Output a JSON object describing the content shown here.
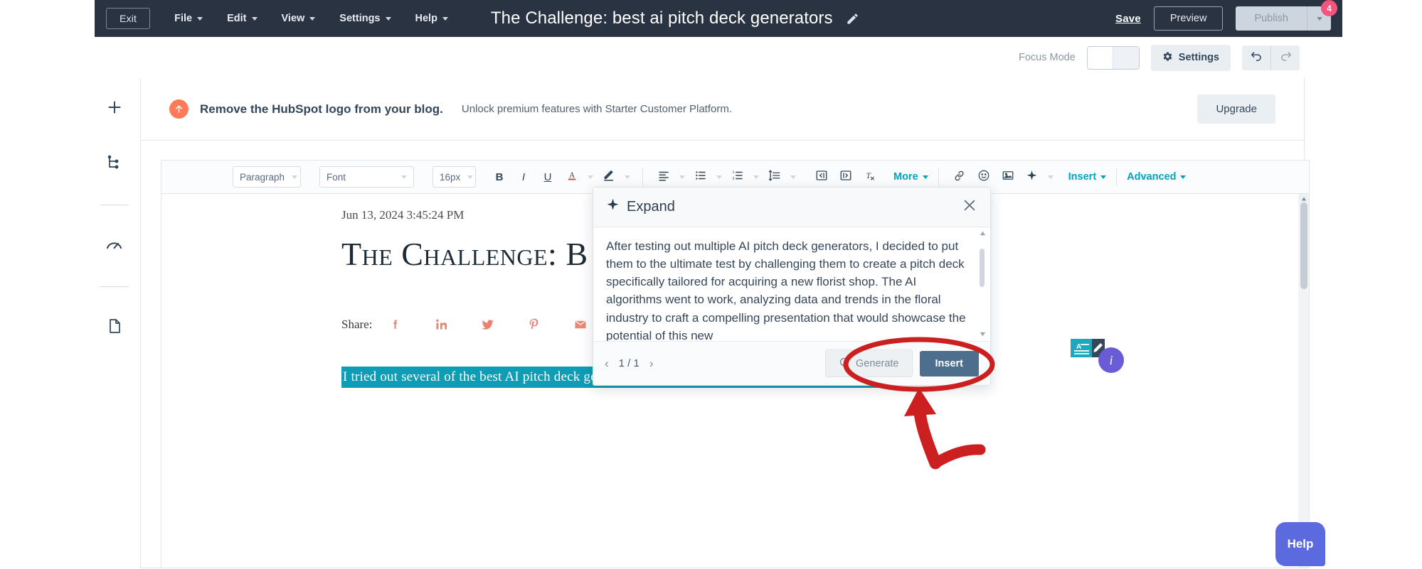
{
  "navbar": {
    "exit_label": "Exit",
    "menus": [
      {
        "label": "File"
      },
      {
        "label": "Edit"
      },
      {
        "label": "View"
      },
      {
        "label": "Settings"
      },
      {
        "label": "Help"
      }
    ],
    "document_title": "The Challenge: best ai pitch deck generators",
    "edit_title_icon": "pencil-icon",
    "save_label": "Save",
    "preview_label": "Preview",
    "publish_label": "Publish",
    "publish_badge_count": "4"
  },
  "subbar": {
    "focus_mode_label": "Focus Mode",
    "focus_mode_on": false,
    "settings_label": "Settings",
    "settings_icon": "gear-icon",
    "undo_icon": "undo-icon",
    "redo_icon": "redo-icon"
  },
  "sidebar": {
    "items": [
      {
        "icon": "plus-icon",
        "name": "add"
      },
      {
        "icon": "hierarchy-icon",
        "name": "structure"
      },
      {
        "icon": "gauge-icon",
        "name": "optimize"
      },
      {
        "icon": "document-icon",
        "name": "content"
      }
    ]
  },
  "banner": {
    "icon": "upgrade-arrow-icon",
    "headline": "Remove the HubSpot logo from your blog.",
    "subtext": "Unlock premium features with Starter Customer Platform.",
    "cta_label": "Upgrade"
  },
  "editor_toolbar": {
    "paragraph_style": "Paragraph",
    "font_family": "Font",
    "font_size": "16px",
    "bold": "B",
    "italic": "I",
    "underline": "U",
    "text_color_icon": "text-color-icon",
    "highlight_icon": "highlighter-icon",
    "align_icon": "align-left-icon",
    "bullet_list_icon": "bulleted-list-icon",
    "numbered_list_icon": "numbered-list-icon",
    "line_height_icon": "line-height-icon",
    "outdent_icon": "outdent-icon",
    "indent_icon": "indent-icon",
    "clear_format_icon": "clear-formatting-icon",
    "more_label": "More",
    "link_icon": "link-icon",
    "emoji_icon": "emoji-icon",
    "image_icon": "image-icon",
    "ai_icon": "ai-sparkle-icon",
    "insert_label": "Insert",
    "advanced_label": "Advanced"
  },
  "document": {
    "date": "Jun 13, 2024 3:45:24 PM",
    "heading": "The Challenge: B",
    "share_label": "Share:",
    "share_icons": [
      {
        "name": "facebook-icon",
        "glyph": "f"
      },
      {
        "name": "linkedin-icon",
        "glyph": "in"
      },
      {
        "name": "twitter-icon",
        "glyph": "ᴠ"
      },
      {
        "name": "pinterest-icon",
        "glyph": "р"
      },
      {
        "name": "email-icon",
        "glyph": "✉"
      }
    ],
    "selected_text": "I tried out several of the best AI pitch deck generators to create a pitch deck for a new florist shop."
  },
  "popup": {
    "icon": "ai-sparkle-icon",
    "title": "Expand",
    "close_icon": "close-icon",
    "body_text": "After testing out multiple AI pitch deck generators, I decided to put them to the ultimate test by challenging them to create a pitch deck specifically tailored for acquiring a new florist shop. The AI algorithms went to work, analyzing data and trends in the floral industry to craft a compelling presentation that would showcase the potential of this new",
    "prev_icon": "chevron-left-icon",
    "next_icon": "chevron-right-icon",
    "page_indicator": "1 / 1",
    "generate_label": "Generate",
    "generate_icon": "refresh-icon",
    "insert_label": "Insert"
  },
  "floating": {
    "content_badge_icon": "content-edit-badge-icon",
    "info_label": "i",
    "help_label": "Help"
  },
  "annotation": {
    "shape": "red-ellipse-and-arrow",
    "color": "#cc1f1f",
    "target": "generate-button"
  },
  "colors": {
    "navbar_bg": "#2a3342",
    "accent_teal": "#00a4bd",
    "selection_bg": "#0f9cb5",
    "hubspot_orange": "#ff7a59",
    "insert_blue": "#4e6e8e",
    "help_purple": "#5c6ae0",
    "badge_pink": "#f2547d"
  }
}
